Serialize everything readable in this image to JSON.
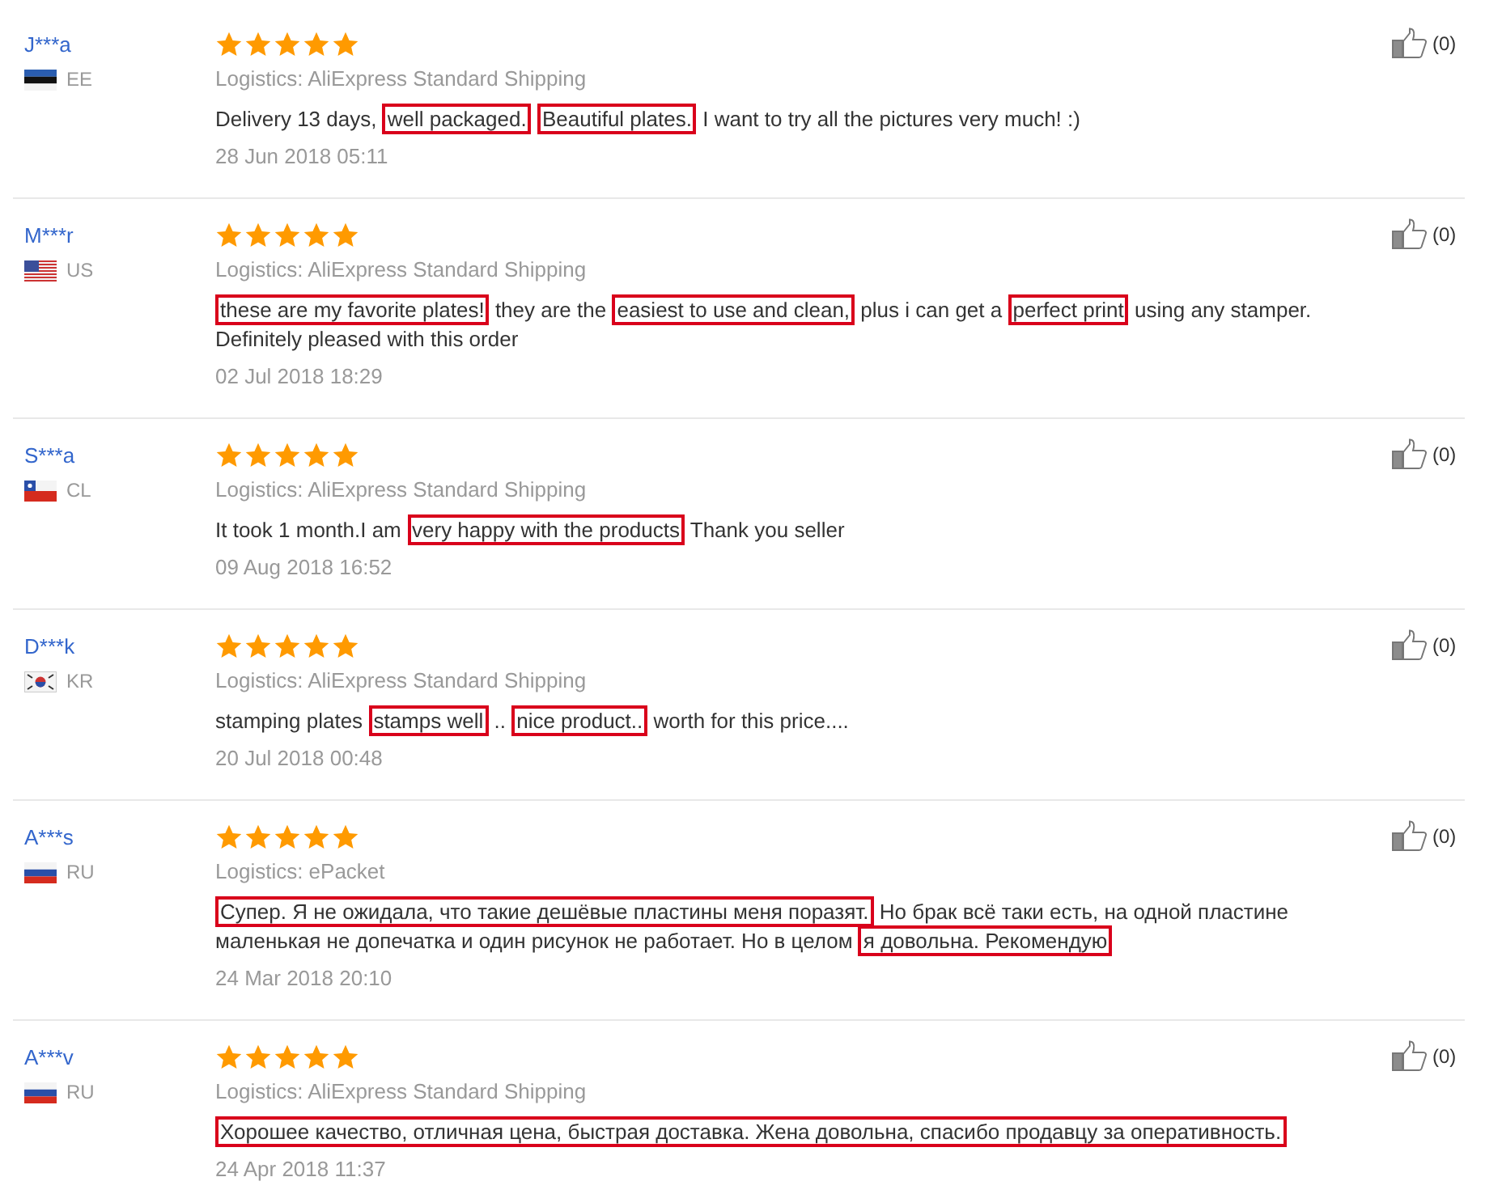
{
  "reviews": [
    {
      "user": "J***a",
      "country": "EE",
      "flag": {
        "kind": "ee"
      },
      "stars": 5,
      "logistics": "Logistics: AliExpress Standard Shipping",
      "text": [
        {
          "t": "Delivery 13 days,",
          "highlighted": false
        },
        {
          "t": "well packaged.",
          "highlighted": true
        },
        {
          "t": "Beautiful plates.",
          "highlighted": true
        },
        {
          "t": "I want to try all the pictures very much! :)",
          "highlighted": false
        }
      ],
      "date": "28 Jun 2018 05:11",
      "likes": "(0)"
    },
    {
      "user": "M***r",
      "country": "US",
      "flag": {
        "kind": "us"
      },
      "stars": 5,
      "logistics": "Logistics: AliExpress Standard Shipping",
      "text": [
        {
          "t": "these are my favorite plates!",
          "highlighted": true
        },
        {
          "t": "they are the",
          "highlighted": false
        },
        {
          "t": "easiest to use and clean,",
          "highlighted": true
        },
        {
          "t": "plus i can get a",
          "highlighted": false
        },
        {
          "t": "perfect print",
          "highlighted": true
        },
        {
          "t": "using any stamper. Definitely pleased with this order",
          "highlighted": false
        }
      ],
      "date": "02 Jul 2018 18:29",
      "likes": "(0)"
    },
    {
      "user": "S***a",
      "country": "CL",
      "flag": {
        "kind": "cl"
      },
      "stars": 5,
      "logistics": "Logistics: AliExpress Standard Shipping",
      "text": [
        {
          "t": "It took 1 month.I am",
          "highlighted": false
        },
        {
          "t": "very happy with the products",
          "highlighted": true
        },
        {
          "t": "Thank you seller",
          "highlighted": false
        }
      ],
      "date": "09 Aug 2018 16:52",
      "likes": "(0)"
    },
    {
      "user": "D***k",
      "country": "KR",
      "flag": {
        "kind": "kr"
      },
      "stars": 5,
      "logistics": "Logistics: AliExpress Standard Shipping",
      "text": [
        {
          "t": "stamping plates",
          "highlighted": false
        },
        {
          "t": "stamps well",
          "highlighted": true
        },
        {
          "t": "..",
          "highlighted": false
        },
        {
          "t": "nice product..",
          "highlighted": true
        },
        {
          "t": "worth for this price....",
          "highlighted": false
        }
      ],
      "date": "20 Jul 2018 00:48",
      "likes": "(0)"
    },
    {
      "user": "A***s",
      "country": "RU",
      "flag": {
        "kind": "ru"
      },
      "stars": 5,
      "logistics": "Logistics: ePacket",
      "text": [
        {
          "t": "Супер. Я не ожидала, что такие дешёвые пластины меня поразят.",
          "highlighted": true
        },
        {
          "t": "Но брак всё таки есть, на одной пластине маленькая не допечатка и один рисунок не работает. Но в целом",
          "highlighted": false
        },
        {
          "t": "я довольна. Рекомендую",
          "highlighted": true
        }
      ],
      "date": "24 Mar 2018 20:10",
      "likes": "(0)"
    },
    {
      "user": "A***v",
      "country": "RU",
      "flag": {
        "kind": "ru"
      },
      "stars": 5,
      "logistics": "Logistics: AliExpress Standard Shipping",
      "text": [
        {
          "t": "Хорошее качество, отличная цена, быстрая доставка. Жена довольна, спасибо продавцу за оперативность.",
          "highlighted": true
        }
      ],
      "date": "24 Apr 2018 11:37",
      "likes": "(0)"
    }
  ]
}
